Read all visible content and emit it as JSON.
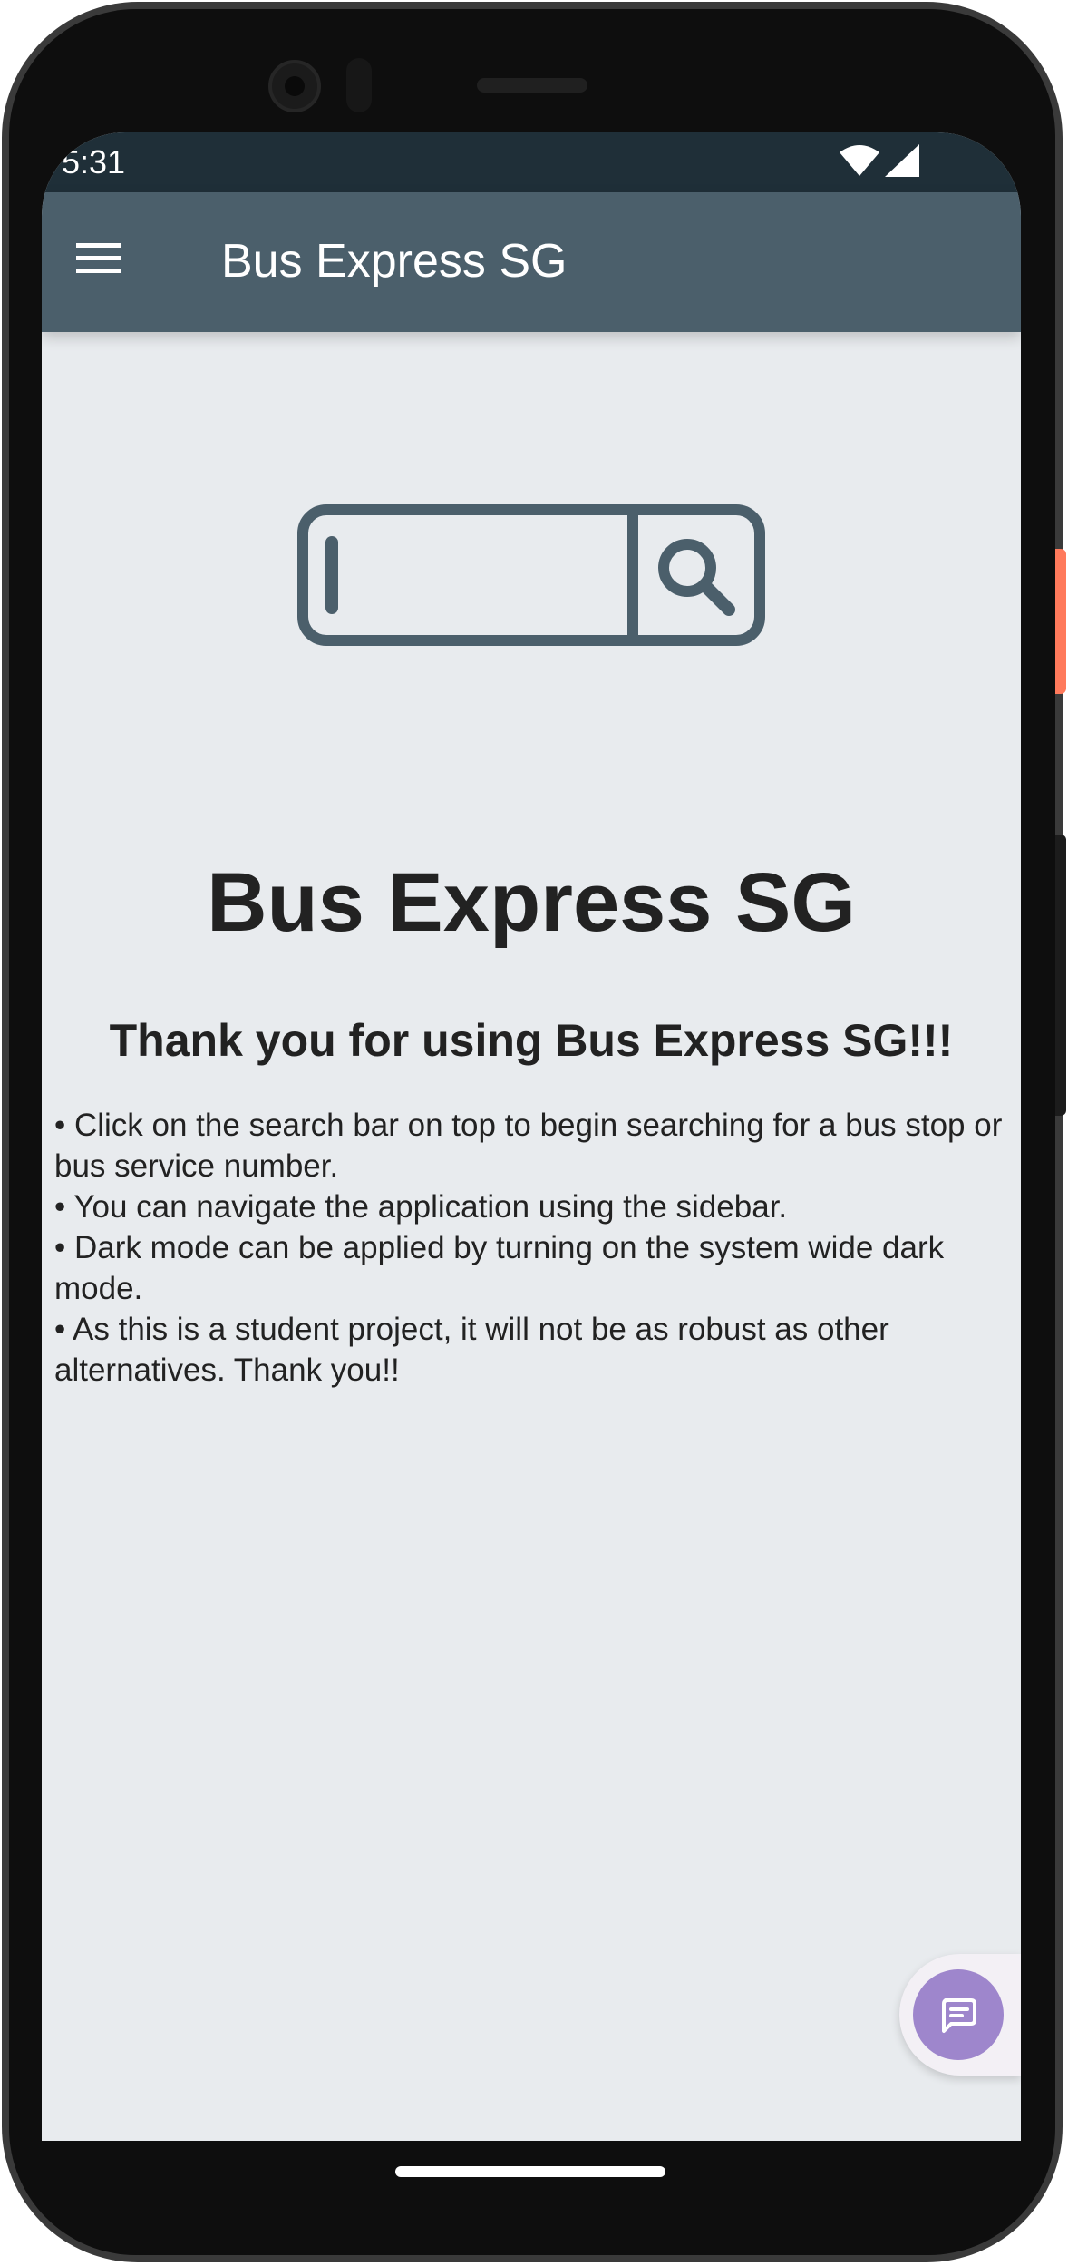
{
  "status_bar": {
    "time": "5:31",
    "icons": [
      "wifi-icon",
      "signal-icon"
    ]
  },
  "app_bar": {
    "menu_icon": "hamburger-menu-icon",
    "title": "Bus Express SG"
  },
  "main": {
    "hero_icon": "search-bar-illustration-icon",
    "heading": "Bus Express SG",
    "subheading": "Thank you for using Bus Express SG!!!",
    "bullets": [
      "• Click on the search bar on top to begin searching for a bus stop or bus service number.",
      " • You can navigate the application using the sidebar.",
      " • Dark mode can be applied by turning on the system wide dark mode.",
      " • As this is a student project, it will not be as robust as other alternatives. Thank you!!"
    ]
  },
  "fab": {
    "icon": "chat-icon",
    "color": "#9e86cc"
  },
  "colors": {
    "status_bar": "#1f2f38",
    "app_bar": "#4b5f6b",
    "background": "#e8ebee",
    "icon_stroke": "#4b5f6b",
    "text": "#222222"
  }
}
